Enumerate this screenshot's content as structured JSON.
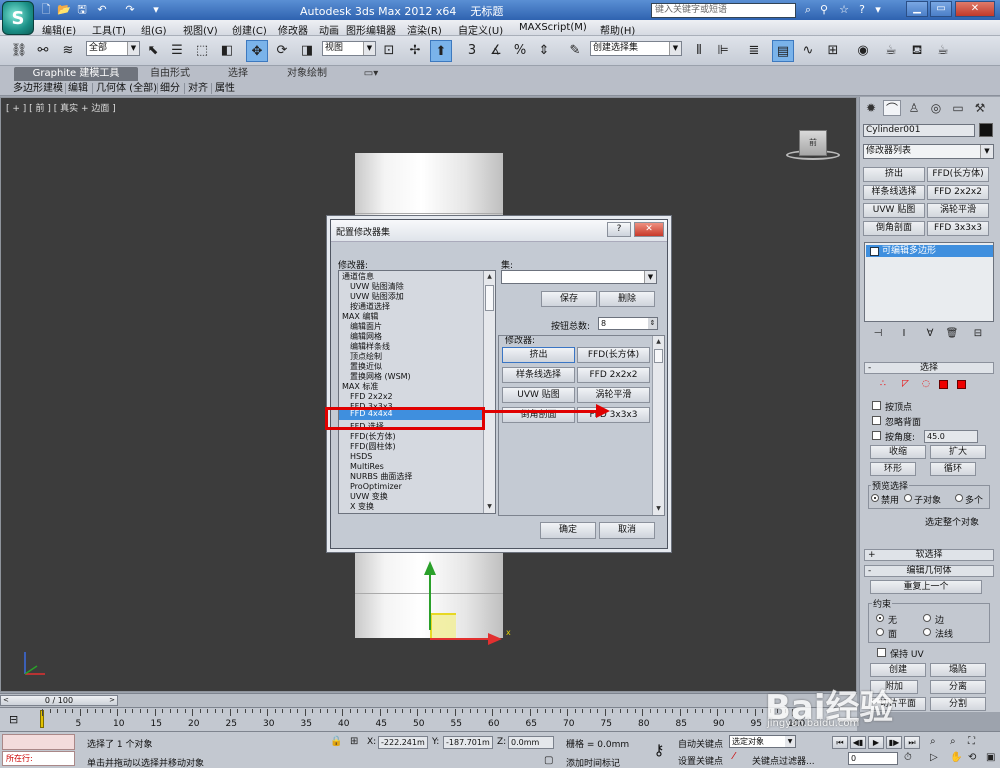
{
  "titlebar": {
    "app_title": "Autodesk 3ds Max  2012 x64",
    "doc_title": "无标题",
    "search_placeholder": "键入关键字或短语"
  },
  "menu": [
    "编辑(E)",
    "工具(T)",
    "组(G)",
    "视图(V)",
    "创建(C)",
    "修改器",
    "动画",
    "图形编辑器",
    "渲染(R)",
    "自定义(U)",
    "MAXScript(M)",
    "帮助(H)"
  ],
  "toolbar": {
    "filter": "全部",
    "ref_coord": "视图",
    "named_selection": "创建选择集",
    "snaps": "3",
    "angle_snap": "%"
  },
  "ribbon": {
    "tabs": [
      "Graphite 建模工具",
      "自由形式",
      "选择",
      "对象绘制"
    ],
    "subtabs": [
      "多边形建模",
      "编辑",
      "几何体 (全部)",
      "细分",
      "对齐",
      "属性"
    ]
  },
  "viewport": {
    "label": "[ + ] [ 前 ] [ 真实 + 边面 ]",
    "viewcube_label": "前",
    "gizmo_x_label": "x"
  },
  "dialog": {
    "title": "配置修改器集",
    "help_btn": "?",
    "close_btn": "✕",
    "modifiers_label": "修改器:",
    "modifier_list": [
      {
        "text": "通道信息",
        "indent": false
      },
      {
        "text": "UVW 贴图清除",
        "indent": true
      },
      {
        "text": "UVW 贴图添加",
        "indent": true
      },
      {
        "text": "按通道选择",
        "indent": true
      },
      {
        "text": "MAX 编辑",
        "indent": false
      },
      {
        "text": "编辑面片",
        "indent": true
      },
      {
        "text": "编辑网格",
        "indent": true
      },
      {
        "text": "编辑样条线",
        "indent": true
      },
      {
        "text": "顶点绘制",
        "indent": true
      },
      {
        "text": "置换近似",
        "indent": true
      },
      {
        "text": "  置换网格 (WSM)",
        "indent": true
      },
      {
        "text": "MAX 标准",
        "indent": false
      },
      {
        "text": "FFD 2x2x2",
        "indent": true
      },
      {
        "text": "FFD 3x3x3",
        "indent": true
      },
      {
        "text": "FFD 4x4x4",
        "indent": true
      },
      {
        "text": "FFD 选择",
        "indent": true
      },
      {
        "text": "FFD(长方体)",
        "indent": true
      },
      {
        "text": "FFD(圆柱体)",
        "indent": true
      },
      {
        "text": "HSDS",
        "indent": true
      },
      {
        "text": "MultiRes",
        "indent": true
      },
      {
        "text": "NURBS 曲面选择",
        "indent": true
      },
      {
        "text": "ProOptimizer",
        "indent": true
      },
      {
        "text": "UVW 变换",
        "indent": true
      },
      {
        "text": "X 变换",
        "indent": true
      }
    ],
    "highlighted_item": "FFD 4x4x4",
    "sets_label": "集:",
    "set_value": "",
    "save_btn": "保存",
    "delete_btn": "删除",
    "total_buttons_label": "按钮总数:",
    "total_buttons": "8",
    "group_modifiers_label": "修改器:",
    "buttons": [
      "挤出",
      "FFD(长方体)",
      "样条线选择",
      "FFD 2x2x2",
      "UVW 贴图",
      "涡轮平滑",
      "倒角剖面",
      "FFD 3x3x3"
    ],
    "ok_btn": "确定",
    "cancel_btn": "取消"
  },
  "command_panel": {
    "object_name": "Cylinder001",
    "modifier_list_label": "修改器列表",
    "buttons": [
      "挤出",
      "FFD(长方体)",
      "样条线选择",
      "FFD 2x2x2",
      "UVW 贴图",
      "涡轮平滑",
      "倒角剖面",
      "FFD 3x3x3"
    ],
    "stack_item": "可编辑多边形",
    "selection": {
      "header": "选择",
      "by_vertex": "按顶点",
      "ignore_backfacing": "忽略背面",
      "by_angle": "按角度:",
      "angle_value": "45.0",
      "shrink": "收缩",
      "grow": "扩大",
      "ring": "环形",
      "loop": "循环",
      "preview_label": "预览选择",
      "preview_opts": [
        "禁用",
        "子对象",
        "多个"
      ],
      "select_whole": "选定整个对象"
    },
    "soft_selection_header": "软选择",
    "edit_geometry": {
      "header": "编辑几何体",
      "repeat_last": "重复上一个",
      "constraints_label": "约束",
      "constraints": [
        "无",
        "边",
        "面",
        "法线"
      ],
      "preserve_uv": "保持 UV",
      "create": "创建",
      "collapse": "塌陷",
      "attach": "附加",
      "detach": "分离",
      "slice_plane": "切片平面",
      "split": "分割"
    }
  },
  "timeline": {
    "slider_label": "0 / 100",
    "ticks": [
      "0",
      "5",
      "10",
      "15",
      "20",
      "25",
      "30",
      "35",
      "40",
      "45",
      "50",
      "55",
      "60",
      "65",
      "70",
      "75",
      "80",
      "85",
      "90",
      "95",
      "100"
    ]
  },
  "status": {
    "running_label": "所在行:",
    "selected_msg": "选择了 1 个对象",
    "prompt_msg": "单击并拖动以选择并移动对象",
    "x_label": "X:",
    "x_value": "-222.241m",
    "y_label": "Y:",
    "y_value": "-187.701m",
    "z_label": "Z:",
    "z_value": "0.0mm",
    "grid": "栅格 = 0.0mm",
    "add_time_tag": "添加时间标记",
    "auto_key": "自动关键点",
    "set_key": "设置关键点",
    "selected_dd": "选定对象",
    "key_filters": "关键点过滤器...",
    "frame": "0"
  },
  "watermark": {
    "brand": "Bai经验",
    "url": "jingyan.baidu.com"
  }
}
